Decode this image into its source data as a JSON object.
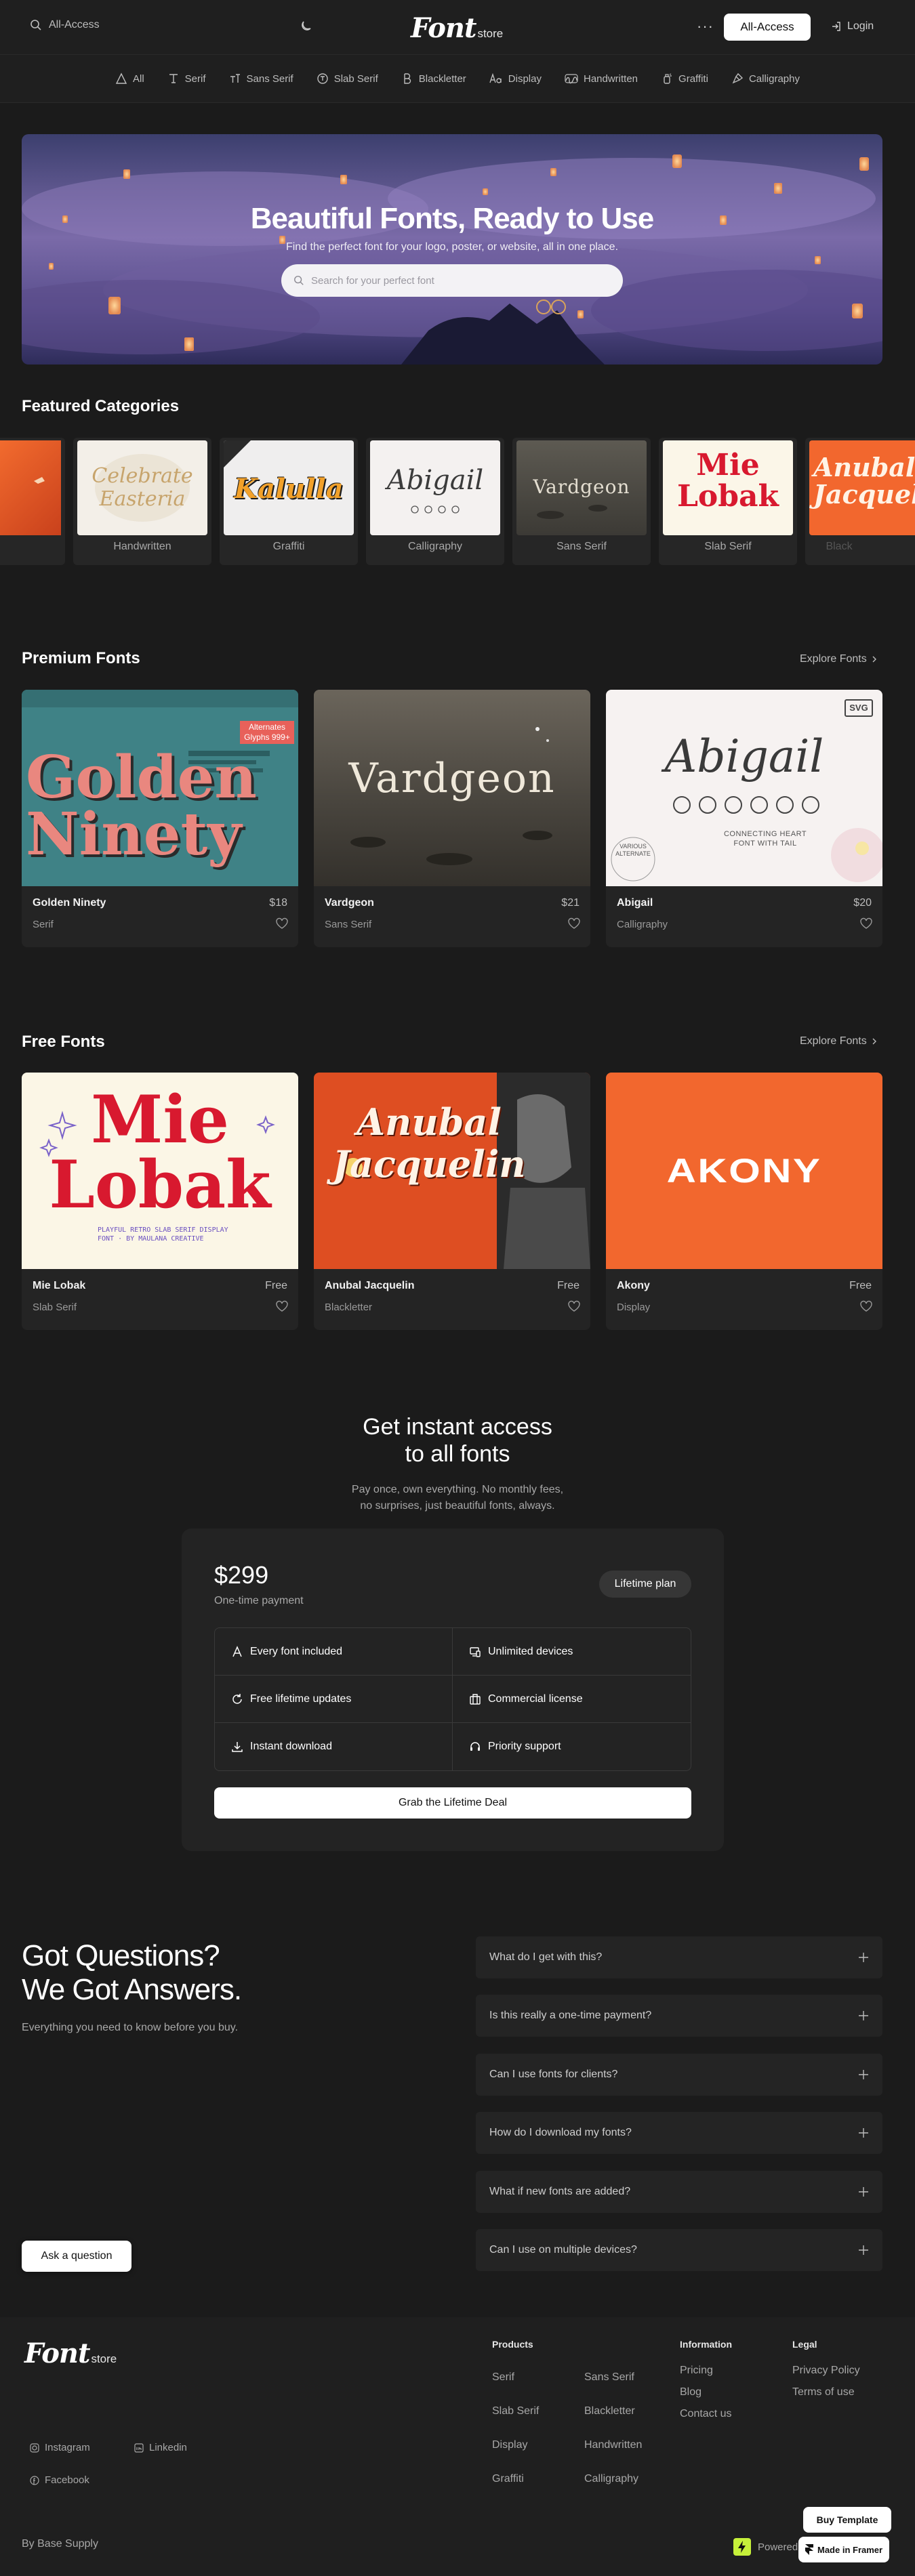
{
  "header": {
    "search_label": "All-Access",
    "logo_main": "Font",
    "logo_sub": "store",
    "menu_dots": "···",
    "all_access_button": "All-Access",
    "login": "Login"
  },
  "nav_categories": [
    {
      "label": "All",
      "icon": "triangle-icon"
    },
    {
      "label": "Serif",
      "icon": "serif-t-icon"
    },
    {
      "label": "Sans Serif",
      "icon": "sans-t-icon"
    },
    {
      "label": "Slab Serif",
      "icon": "slab-icon"
    },
    {
      "label": "Blackletter",
      "icon": "blackletter-b-icon"
    },
    {
      "label": "Display",
      "icon": "display-aa-icon"
    },
    {
      "label": "Handwritten",
      "icon": "handwritten-icon"
    },
    {
      "label": "Graffiti",
      "icon": "graffiti-icon"
    },
    {
      "label": "Calligraphy",
      "icon": "calligraphy-pen-icon"
    }
  ],
  "hero": {
    "title": "Beautiful Fonts, Ready to Use",
    "subtitle": "Find the perfect font for your logo, poster, or website, all in one place.",
    "search_placeholder": "Search for your perfect font"
  },
  "featured": {
    "title": "Featured Categories",
    "items": [
      {
        "label": "Handwritten",
        "art": "Celebrate Easteria"
      },
      {
        "label": "Graffiti",
        "art": "Kalulla"
      },
      {
        "label": "Calligraphy",
        "art": "Abigail"
      },
      {
        "label": "Sans Serif",
        "art": "Vardgeon"
      },
      {
        "label": "Slab Serif",
        "art": "Mie Lobak"
      },
      {
        "label": "Black",
        "art": "Anubal Jacquelin"
      }
    ]
  },
  "premium": {
    "title": "Premium Fonts",
    "explore": "Explore Fonts",
    "items": [
      {
        "name": "Golden Ninety",
        "price": "$18",
        "category": "Serif",
        "art": "Golden Ninety",
        "badge": "Alternates Glyphs 999+"
      },
      {
        "name": "Vardgeon",
        "price": "$21",
        "category": "Sans Serif",
        "art": "Vardgeon"
      },
      {
        "name": "Abigail",
        "price": "$20",
        "category": "Calligraphy",
        "art": "Abigail",
        "art_sub": "CONNECTING HEART FONT WITH TAIL",
        "badge": "VARIOUS ALTERNATE",
        "svg_badge": "SVG"
      }
    ]
  },
  "free": {
    "title": "Free Fonts",
    "explore": "Explore Fonts",
    "items": [
      {
        "name": "Mie Lobak",
        "price": "Free",
        "category": "Slab Serif",
        "art": "Mie Lobak",
        "art_sub": "PLAYFUL RETRO SLAB SERIF DISPLAY FONT · BY MAULANA CREATIVE"
      },
      {
        "name": "Anubal Jacquelin",
        "price": "Free",
        "category": "Blackletter",
        "art": "Anubal Jacquelin"
      },
      {
        "name": "Akony",
        "price": "Free",
        "category": "Display",
        "art": "AKONY"
      }
    ]
  },
  "pricing": {
    "title_line1": "Get instant access",
    "title_line2": "to all fonts",
    "sub_line1": "Pay once, own everything. No monthly fees,",
    "sub_line2": "no surprises, just beautiful fonts, always.",
    "price": "$299",
    "payment_note": "One-time payment",
    "plan_badge": "Lifetime plan",
    "features": [
      {
        "label": "Every font included",
        "icon": "font-a-icon"
      },
      {
        "label": "Unlimited devices",
        "icon": "devices-icon"
      },
      {
        "label": "Free lifetime updates",
        "icon": "refresh-icon"
      },
      {
        "label": "Commercial license",
        "icon": "briefcase-icon"
      },
      {
        "label": "Instant download",
        "icon": "download-icon"
      },
      {
        "label": "Priority support",
        "icon": "headset-icon"
      }
    ],
    "cta": "Grab the Lifetime Deal"
  },
  "faq": {
    "title_line1": "Got Questions?",
    "title_line2": "We Got Answers.",
    "subtitle": "Everything you need to know before you buy.",
    "ask_button": "Ask a question",
    "items": [
      "What do I get with this?",
      "Is this really a one-time payment?",
      "Can I use fonts for clients?",
      "How do I download my fonts?",
      "What if new fonts are added?",
      "Can I use on multiple devices?"
    ]
  },
  "footer": {
    "logo_main": "Font",
    "logo_sub": "store",
    "products_title": "Products",
    "products": [
      "Serif",
      "Sans Serif",
      "Slab Serif",
      "Blackletter",
      "Display",
      "Handwritten",
      "Graffiti",
      "Calligraphy"
    ],
    "information_title": "Information",
    "information": [
      "Pricing",
      "Blog",
      "Contact us"
    ],
    "legal_title": "Legal",
    "legal": [
      "Privacy Policy",
      "Terms of use"
    ],
    "social": [
      {
        "label": "Instagram",
        "icon": "instagram-icon"
      },
      {
        "label": "Linkedin",
        "icon": "linkedin-icon"
      },
      {
        "label": "Facebook",
        "icon": "facebook-icon"
      }
    ],
    "byline": "By Base Supply",
    "powered": "Powered",
    "buy_template": "Buy Template",
    "made_in_framer": "Made in Framer"
  },
  "colors": {
    "background": "#1b1b1b",
    "surface": "#242424",
    "accent_red": "#d8192f",
    "akony_orange": "#f2672e",
    "teal": "#3a7b7f"
  }
}
